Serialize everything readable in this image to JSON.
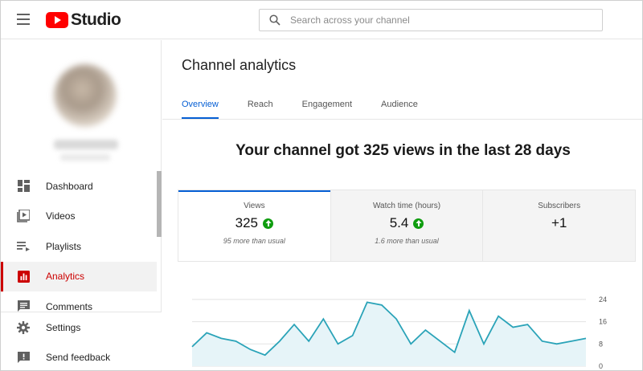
{
  "header": {
    "logo_text": "Studio",
    "search_placeholder": "Search across your channel"
  },
  "sidebar": {
    "items": [
      {
        "label": "Dashboard",
        "icon": "dashboard-icon"
      },
      {
        "label": "Videos",
        "icon": "videos-icon"
      },
      {
        "label": "Playlists",
        "icon": "playlists-icon"
      },
      {
        "label": "Analytics",
        "icon": "analytics-icon",
        "active": true
      },
      {
        "label": "Comments",
        "icon": "comments-icon"
      }
    ],
    "bottom_items": [
      {
        "label": "Settings",
        "icon": "gear-icon"
      },
      {
        "label": "Send feedback",
        "icon": "feedback-icon"
      }
    ]
  },
  "main": {
    "title": "Channel analytics",
    "tabs": [
      {
        "label": "Overview",
        "active": true
      },
      {
        "label": "Reach"
      },
      {
        "label": "Engagement"
      },
      {
        "label": "Audience"
      }
    ],
    "headline": "Your channel got 325 views in the last 28 days",
    "cards": [
      {
        "label": "Views",
        "value": "325",
        "trend": "up",
        "note": "95 more than usual"
      },
      {
        "label": "Watch time (hours)",
        "value": "5.4",
        "trend": "up",
        "note": "1.6 more than usual"
      },
      {
        "label": "Subscribers",
        "value": "+1"
      }
    ]
  },
  "colors": {
    "accent": "#065fd4",
    "brand_red": "#ff0000",
    "active_nav": "#cc0000",
    "trend_up": "#0f9d0f",
    "chart_line": "#2aa3b8",
    "chart_fill": "#e6f4f8"
  },
  "chart_data": {
    "type": "area",
    "series": [
      {
        "values": [
          7,
          12,
          10,
          9,
          6,
          4,
          9,
          15,
          9,
          17,
          8,
          11,
          23,
          22,
          17,
          8,
          13,
          9,
          5,
          20,
          8,
          18,
          14,
          15,
          9,
          8,
          9,
          10
        ]
      }
    ],
    "y_ticks": [
      0,
      8,
      16,
      24
    ],
    "ylim": [
      0,
      26
    ],
    "grid": true
  }
}
